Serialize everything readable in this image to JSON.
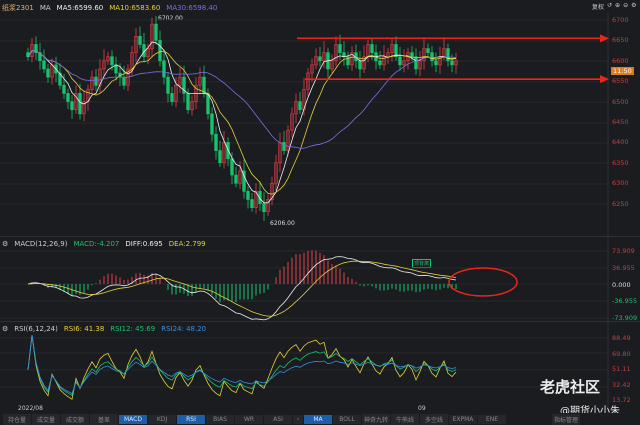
{
  "header": {
    "symbol": "纸浆2301",
    "ma_label": "MA",
    "ma5": "MA5:6599.60",
    "ma10": "MA10:6583.60",
    "ma30": "MA30:6598.40",
    "right_label": "复权"
  },
  "main_axis": {
    "ticks": [
      "6700",
      "6650",
      "6600",
      "6550",
      "6500",
      "6450",
      "6400",
      "6350",
      "6300",
      "6250"
    ],
    "current_time_tag": "11:50"
  },
  "annotations": {
    "high": "6702.00",
    "low": "6206.00"
  },
  "macd": {
    "label": "MACD(12,26,9)",
    "macd": "MACD:-4.207",
    "diff": "DIFF:0.695",
    "dea": "DEA:2.799",
    "ticks": [
      "73.909",
      "36.955",
      "0.000",
      "-36.955",
      "-73.909"
    ],
    "note": "顶背离"
  },
  "rsi": {
    "label": "RSI(6,12,24)",
    "rsi6": "RSI6: 41.38",
    "rsi12": "RSI12: 45.69",
    "rsi24": "RSI24: 48.20",
    "ticks": [
      "88.49",
      "69.80",
      "51.11",
      "32.42",
      "13.72"
    ]
  },
  "x_axis": {
    "start": "2022/08",
    "mid": "09"
  },
  "watermark": {
    "brand": "老虎社区",
    "author": "@期货小小朱"
  },
  "tabs_left": [
    "持仓量",
    "成交量",
    "成交额",
    "基差",
    "MACD",
    "KDJ",
    "RSI",
    "BIAS",
    "WR",
    "ASI"
  ],
  "tabs_right": [
    "MA",
    "BOLL",
    "神奇九转",
    "牛熊线",
    "多空线",
    "EXPMA",
    "ENE"
  ],
  "tab_manage": "指标管理",
  "active_tabs": [
    "MACD",
    "RSI",
    "MA"
  ],
  "colors": {
    "up": "#e0404a",
    "down": "#19c36e",
    "ma5": "#f0f0f0",
    "ma10": "#e6d03c",
    "ma30": "#7a6fe0",
    "level": "#e8261e"
  },
  "levels": [
    6655,
    6555
  ],
  "chart_data": {
    "type": "candlestick",
    "ylim": [
      6190,
      6715
    ],
    "closes": [
      6610,
      6640,
      6620,
      6600,
      6580,
      6560,
      6590,
      6570,
      6540,
      6520,
      6500,
      6480,
      6520,
      6470,
      6500,
      6530,
      6560,
      6540,
      6580,
      6600,
      6610,
      6590,
      6570,
      6560,
      6540,
      6580,
      6620,
      6660,
      6640,
      6610,
      6630,
      6690,
      6650,
      6600,
      6560,
      6520,
      6500,
      6540,
      6560,
      6520,
      6480,
      6500,
      6540,
      6560,
      6520,
      6470,
      6420,
      6380,
      6350,
      6400,
      6360,
      6320,
      6300,
      6330,
      6280,
      6260,
      6240,
      6280,
      6250,
      6230,
      6260,
      6300,
      6350,
      6400,
      6380,
      6430,
      6470,
      6500,
      6480,
      6530,
      6570,
      6590,
      6610,
      6600,
      6620,
      6580,
      6600,
      6640,
      6620,
      6610,
      6590,
      6620,
      6600,
      6580,
      6610,
      6640,
      6620,
      6600,
      6590,
      6610,
      6620,
      6640,
      6610,
      6590,
      6600,
      6620,
      6610,
      6580,
      6600,
      6630,
      6620,
      6600,
      6590,
      6610,
      6630,
      6600,
      6590,
      6600
    ]
  }
}
